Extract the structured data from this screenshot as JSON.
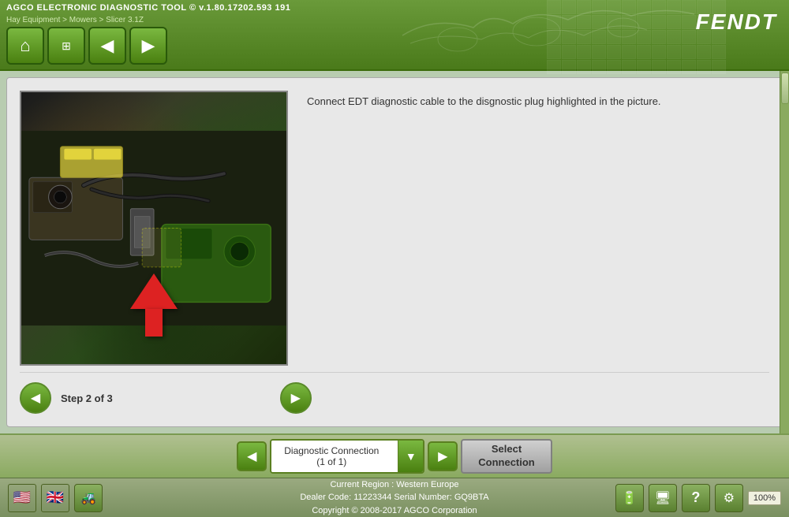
{
  "app": {
    "title": "AGCO ELECTRONIC DIAGNOSTIC TOOL",
    "version": "v.1.80.17202.593 191",
    "breadcrumb": "Hay Equipment > Mowers > Slicer 3.1Z",
    "logo": "FENDT"
  },
  "nav_buttons": [
    {
      "id": "home",
      "icon": "⌂",
      "label": "Home"
    },
    {
      "id": "menu",
      "icon": "☰",
      "label": "Menu"
    },
    {
      "id": "back",
      "icon": "◀",
      "label": "Back"
    },
    {
      "id": "forward",
      "icon": "▶",
      "label": "Forward"
    }
  ],
  "content": {
    "instruction": "Connect EDT diagnostic cable to the disgnostic plug highlighted in the picture.",
    "step_label": "Step 2 of 3"
  },
  "connection": {
    "label_line1": "Diagnostic Connection",
    "label_line2": "(1 of 1)",
    "dropdown_icon": "▼",
    "select_button": "Select\nConnection"
  },
  "status_bar": {
    "line1": "Current Region : Western Europe",
    "line2": "Dealer Code: 11223344    Serial Number: GQ9BTA",
    "line3": "Copyright © 2008-2017 AGCO Corporation"
  },
  "icons": {
    "prev_arrow": "◀",
    "next_arrow": "▶",
    "settings": "⚙",
    "help": "?",
    "zoom": "100%"
  }
}
